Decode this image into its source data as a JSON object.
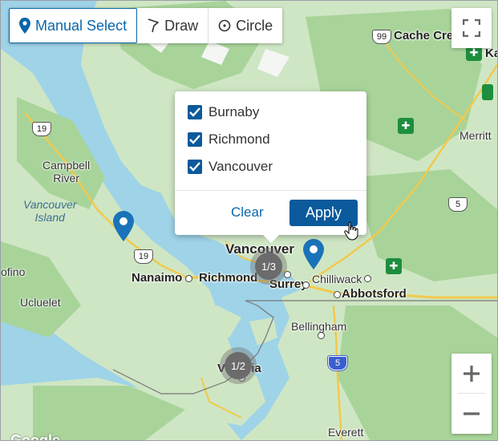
{
  "toolbar": {
    "manual_select": "Manual Select",
    "draw": "Draw",
    "circle": "Circle"
  },
  "popup": {
    "options": [
      {
        "label": "Burnaby",
        "checked": true
      },
      {
        "label": "Richmond",
        "checked": true
      },
      {
        "label": "Vancouver",
        "checked": true
      }
    ],
    "clear_label": "Clear",
    "apply_label": "Apply"
  },
  "clusters": [
    {
      "label": "1/3"
    },
    {
      "label": "1/2"
    }
  ],
  "places": {
    "cache_creek": "Cache Creek",
    "kamloops_partial": "Ka",
    "merritt": "Merritt",
    "campbell_river": "Campbell\nRiver",
    "vancouver_island": "Vancouver\nIsland",
    "tofino_partial": "ofino",
    "ucluelet": "Ucluelet",
    "nanaimo": "Nanaimo",
    "richmond": "Richmond",
    "vancouver": "Vancouver",
    "surrey": "Surrey",
    "chilliwack": "Chilliwack",
    "abbotsford": "Abbotsford",
    "bellingham": "Bellingham",
    "victoria": "Victoria",
    "everett": "Everett"
  },
  "highway_shields": {
    "h99": "99",
    "h19_north": "19",
    "h19_south": "19",
    "h5": "5",
    "i5": "5"
  },
  "attribution": "Google",
  "colors": {
    "accent": "#0a5a9c",
    "land": "#cfe6c4",
    "forest": "#a8d49a",
    "water": "#9fd3e8",
    "cluster": "#6b6b6b",
    "pin": "#1a73b8"
  }
}
